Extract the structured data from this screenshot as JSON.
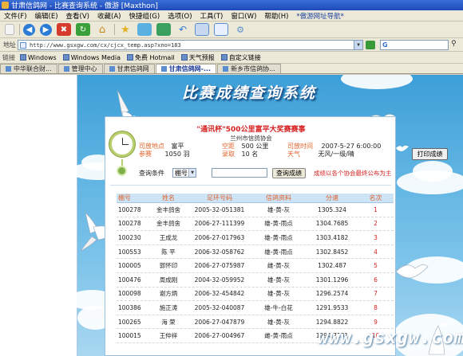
{
  "window": {
    "title": "甘肃信鸽网 - 比赛查询系统 - 傲游 [Maxthon]"
  },
  "menu": [
    "文件(F)",
    "编辑(E)",
    "查看(V)",
    "收藏(A)",
    "快捷组(G)",
    "选项(O)",
    "工具(T)",
    "窗口(W)",
    "帮助(H)",
    "*傲游网址导航*"
  ],
  "address": {
    "label": "地址",
    "url": "http://www.gsxgw.com/cx/cjcx_temp.asp?xno=183",
    "search_placeholder": ""
  },
  "links": {
    "label": "链接",
    "items": [
      "Windows",
      "Windows Media",
      "免费 Hotmail",
      "天气预报",
      "自定义链接"
    ]
  },
  "tabs": [
    {
      "label": "中华联合财...",
      "active": false
    },
    {
      "label": "管理中心",
      "active": false
    },
    {
      "label": "甘肃信鸽网",
      "active": false
    },
    {
      "label": "甘肃信鸽网-...",
      "active": true
    },
    {
      "label": "新乡市信鸽协...",
      "active": false
    }
  ],
  "page": {
    "banner_title": "比赛成绩查询系统",
    "race": {
      "title_red": "\"通讯杯\"500公里富平大奖赛赛事",
      "host": "兰州市信鸽协会",
      "release_place_label": "司放地点",
      "release_place": "富平",
      "distance_label": "空距",
      "distance": "500 公里",
      "release_time_label": "司放时间",
      "release_time": "2007-5-27 6:00:00",
      "entrants_label": "参赛",
      "entrants": "1050 羽",
      "admitted_label": "录取",
      "admitted": "10 名",
      "weather_label": "天气",
      "weather": "无风/一级/晴"
    },
    "query": {
      "label": "查询条件",
      "select_value": "棚号",
      "button": "查询成绩",
      "note": "成绩以各个协会最终公布为主"
    },
    "print_button": "打印成绩",
    "table": {
      "headers": [
        "棚号",
        "姓名",
        "足环号码",
        "信鸽资料",
        "分速",
        "名次"
      ],
      "rows": [
        [
          "100278",
          "金丰鸽舍",
          "2005-32-051381",
          "雄-黄-灰",
          "1305.324",
          "1"
        ],
        [
          "100278",
          "金丰鸽舍",
          "2006-27-111399",
          "雄-黄-雨点",
          "1304.7685",
          "2"
        ],
        [
          "100230",
          "王成龙",
          "2006-27-017963",
          "雄-黄-雨点",
          "1303.4182",
          "3"
        ],
        [
          "100553",
          "陈 平",
          "2006-32-058762",
          "雄-黄-雨点",
          "1302.8452",
          "4"
        ],
        [
          "100005",
          "郭怀印",
          "2006-27-075987",
          "雌-黄-灰",
          "1302.487",
          "5"
        ],
        [
          "100476",
          "周成刚",
          "2004-32-059952",
          "雄-黄-灰",
          "1301.1296",
          "6"
        ],
        [
          "100098",
          "谢方炳",
          "2006-32-454842",
          "雄-黄-灰",
          "1296.2574",
          "7"
        ],
        [
          "100386",
          "施正涛",
          "2005-32-040087",
          "雄-牛-白花",
          "1291.9533",
          "8"
        ],
        [
          "100265",
          "海 荣",
          "2006-27-047879",
          "雄-黄-灰",
          "1294.8822",
          "9"
        ],
        [
          "100015",
          "王仲祥",
          "2006-27-004967",
          "雌-黄-雨点",
          "1294.7131",
          "10"
        ]
      ]
    },
    "watermark": "www.gsxgw.com"
  }
}
